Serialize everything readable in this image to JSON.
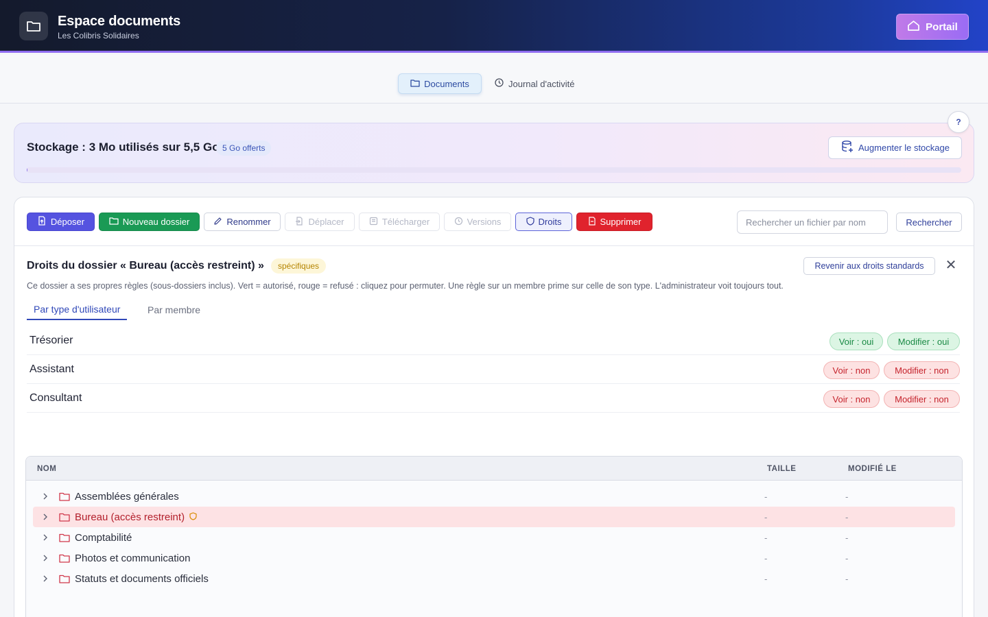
{
  "header": {
    "title": "Espace documents",
    "subtitle": "Les Colibris Solidaires",
    "portal_label": "Portail"
  },
  "tabs": [
    {
      "label": "Documents",
      "active": true
    },
    {
      "label": "Journal d'activité",
      "active": false
    }
  ],
  "help_label": "?",
  "storage": {
    "title": "Stockage : 3 Mo utilisés sur 5,5 Go",
    "badge": "5 Go offerts",
    "button_label": "Augmenter le stockage",
    "used_fraction": 0.0005
  },
  "toolbar": {
    "upload": "Déposer",
    "new_folder": "Nouveau dossier",
    "rename": "Renommer",
    "move": "Déplacer",
    "download": "Télécharger",
    "versions": "Versions",
    "rights": "Droits",
    "delete": "Supprimer",
    "search_placeholder": "Rechercher un fichier par nom",
    "search_button": "Rechercher"
  },
  "rights": {
    "title": "Droits du dossier « Bureau (accès restreint) »",
    "badge": "spécifiques",
    "revert_label": "Revenir aux droits standards",
    "close": "✕",
    "description": "Ce dossier a ses propres règles (sous-dossiers inclus). Vert = autorisé, rouge = refusé : cliquez pour permuter. Une règle sur un membre prime sur celle de son type. L'administrateur voit toujours tout.",
    "tab_by_type": "Par type d'utilisateur",
    "tab_by_member": "Par membre",
    "roles": [
      {
        "name": "Trésorier",
        "view": "Voir : oui",
        "edit": "Modifier : oui",
        "view_allowed": true,
        "edit_allowed": true
      },
      {
        "name": "Assistant",
        "view": "Voir : non",
        "edit": "Modifier : non",
        "view_allowed": false,
        "edit_allowed": false
      },
      {
        "name": "Consultant",
        "view": "Voir : non",
        "edit": "Modifier : non",
        "view_allowed": false,
        "edit_allowed": false
      }
    ]
  },
  "files": {
    "columns": {
      "name": "NOM",
      "size": "TAILLE",
      "modified": "MODIFIÉ LE"
    },
    "rows": [
      {
        "name": "Assemblées générales",
        "size": "-",
        "modified": "-",
        "selected": false
      },
      {
        "name": "Bureau (accès restreint)",
        "size": "-",
        "modified": "-",
        "selected": true
      },
      {
        "name": "Comptabilité",
        "size": "-",
        "modified": "-",
        "selected": false
      },
      {
        "name": "Photos et communication",
        "size": "-",
        "modified": "-",
        "selected": false
      },
      {
        "name": "Statuts et documents officiels",
        "size": "-",
        "modified": "-",
        "selected": false
      }
    ]
  },
  "colors": {
    "accent": "#5553e0",
    "success": "#1a9a55",
    "danger": "#e0232d",
    "folder_icon": "#d0364a"
  }
}
